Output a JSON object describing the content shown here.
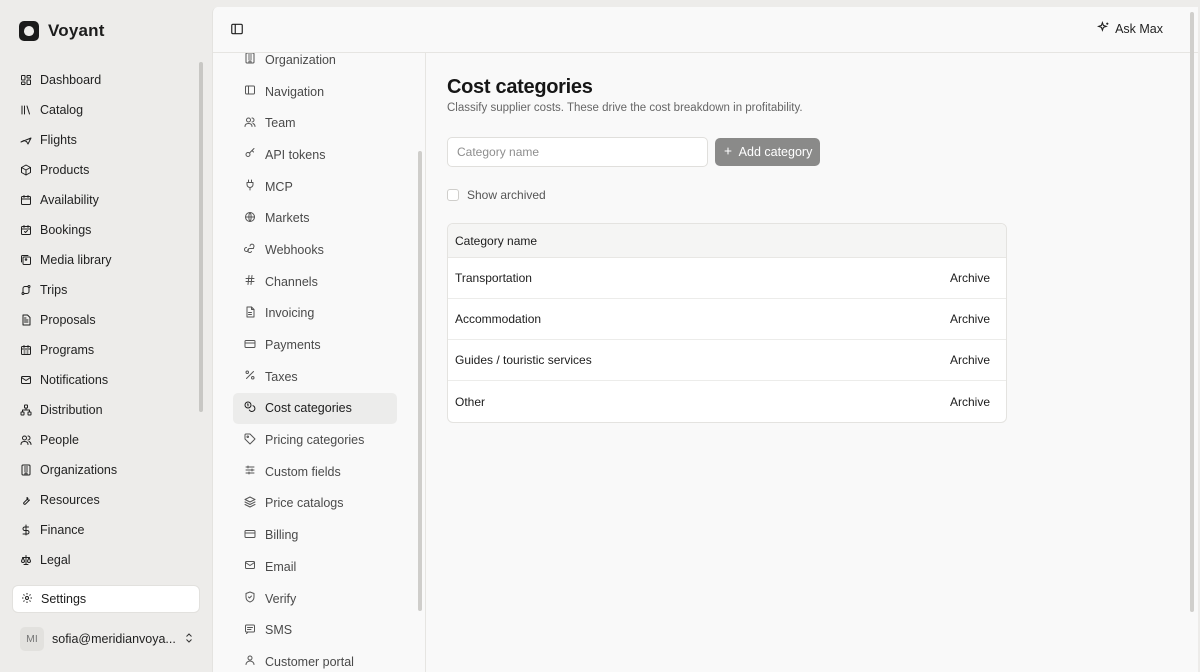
{
  "brand": {
    "name": "Voyant"
  },
  "sidebar": {
    "items": [
      {
        "label": "Dashboard",
        "icon": "dashboard-icon"
      },
      {
        "label": "Catalog",
        "icon": "library-icon"
      },
      {
        "label": "Flights",
        "icon": "plane-icon"
      },
      {
        "label": "Products",
        "icon": "package-icon"
      },
      {
        "label": "Availability",
        "icon": "calendar-icon"
      },
      {
        "label": "Bookings",
        "icon": "calendar-check-icon"
      },
      {
        "label": "Media library",
        "icon": "images-icon"
      },
      {
        "label": "Trips",
        "icon": "route-icon"
      },
      {
        "label": "Proposals",
        "icon": "file-text-icon"
      },
      {
        "label": "Programs",
        "icon": "calendar-grid-icon"
      },
      {
        "label": "Notifications",
        "icon": "mail-icon"
      },
      {
        "label": "Distribution",
        "icon": "network-icon"
      },
      {
        "label": "People",
        "icon": "users-icon"
      },
      {
        "label": "Organizations",
        "icon": "building-icon"
      },
      {
        "label": "Resources",
        "icon": "wrench-icon"
      },
      {
        "label": "Finance",
        "icon": "dollar-icon"
      },
      {
        "label": "Legal",
        "icon": "scale-icon"
      }
    ],
    "settings_label": "Settings",
    "user": {
      "initials": "MI",
      "email": "sofia@meridianvoya..."
    }
  },
  "topbar": {
    "ask_label": "Ask Max"
  },
  "settings_nav": {
    "items": [
      {
        "label": "Organization",
        "icon": "building-icon",
        "active": false
      },
      {
        "label": "Navigation",
        "icon": "panel-icon",
        "active": false
      },
      {
        "label": "Team",
        "icon": "users-icon",
        "active": false
      },
      {
        "label": "API tokens",
        "icon": "key-icon",
        "active": false
      },
      {
        "label": "MCP",
        "icon": "plug-icon",
        "active": false
      },
      {
        "label": "Markets",
        "icon": "globe-icon",
        "active": false
      },
      {
        "label": "Webhooks",
        "icon": "webhook-icon",
        "active": false
      },
      {
        "label": "Channels",
        "icon": "hash-icon",
        "active": false
      },
      {
        "label": "Invoicing",
        "icon": "file-icon",
        "active": false
      },
      {
        "label": "Payments",
        "icon": "credit-card-icon",
        "active": false
      },
      {
        "label": "Taxes",
        "icon": "percent-icon",
        "active": false
      },
      {
        "label": "Cost categories",
        "icon": "coins-icon",
        "active": true
      },
      {
        "label": "Pricing categories",
        "icon": "tag-icon",
        "active": false
      },
      {
        "label": "Custom fields",
        "icon": "sliders-icon",
        "active": false
      },
      {
        "label": "Price catalogs",
        "icon": "layers-icon",
        "active": false
      },
      {
        "label": "Billing",
        "icon": "credit-card-icon",
        "active": false
      },
      {
        "label": "Email",
        "icon": "mail-icon",
        "active": false
      },
      {
        "label": "Verify",
        "icon": "shield-icon",
        "active": false
      },
      {
        "label": "SMS",
        "icon": "message-icon",
        "active": false
      },
      {
        "label": "Customer portal",
        "icon": "user-icon",
        "active": false
      }
    ]
  },
  "page": {
    "title": "Cost categories",
    "subtitle": "Classify supplier costs. These drive the cost breakdown in profitability.",
    "input_placeholder": "Category name",
    "add_label": "Add category",
    "show_archived_label": "Show archived",
    "table": {
      "header": "Category name",
      "action_label": "Archive",
      "rows": [
        "Transportation",
        "Accommodation",
        "Guides / touristic services",
        "Other"
      ]
    }
  },
  "colors": {
    "accent_button": "#8a8a89",
    "sidebar_bg": "#edecea",
    "panel_bg": "#f9f9f9"
  }
}
